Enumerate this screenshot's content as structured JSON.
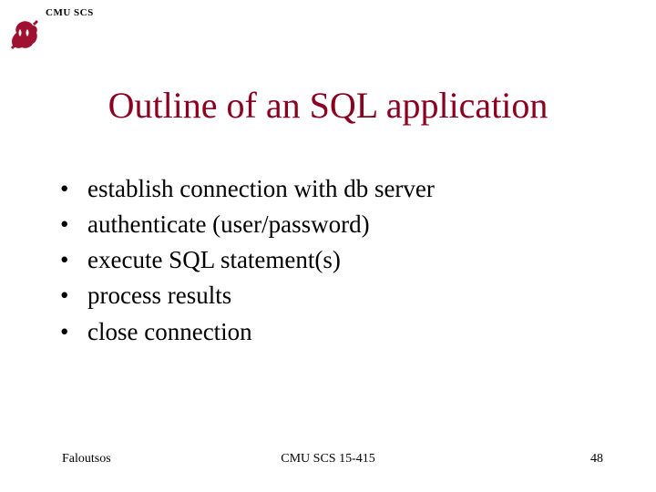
{
  "header": {
    "label": "CMU SCS"
  },
  "title": "Outline of an SQL application",
  "bullets": [
    "establish connection with db server",
    "authenticate (user/password)",
    "execute SQL statement(s)",
    "process results",
    "close connection"
  ],
  "footer": {
    "left": "Faloutsos",
    "center": "CMU SCS 15-415",
    "right": "48"
  },
  "colors": {
    "title": "#8b0020",
    "mascot": "#a01030"
  }
}
